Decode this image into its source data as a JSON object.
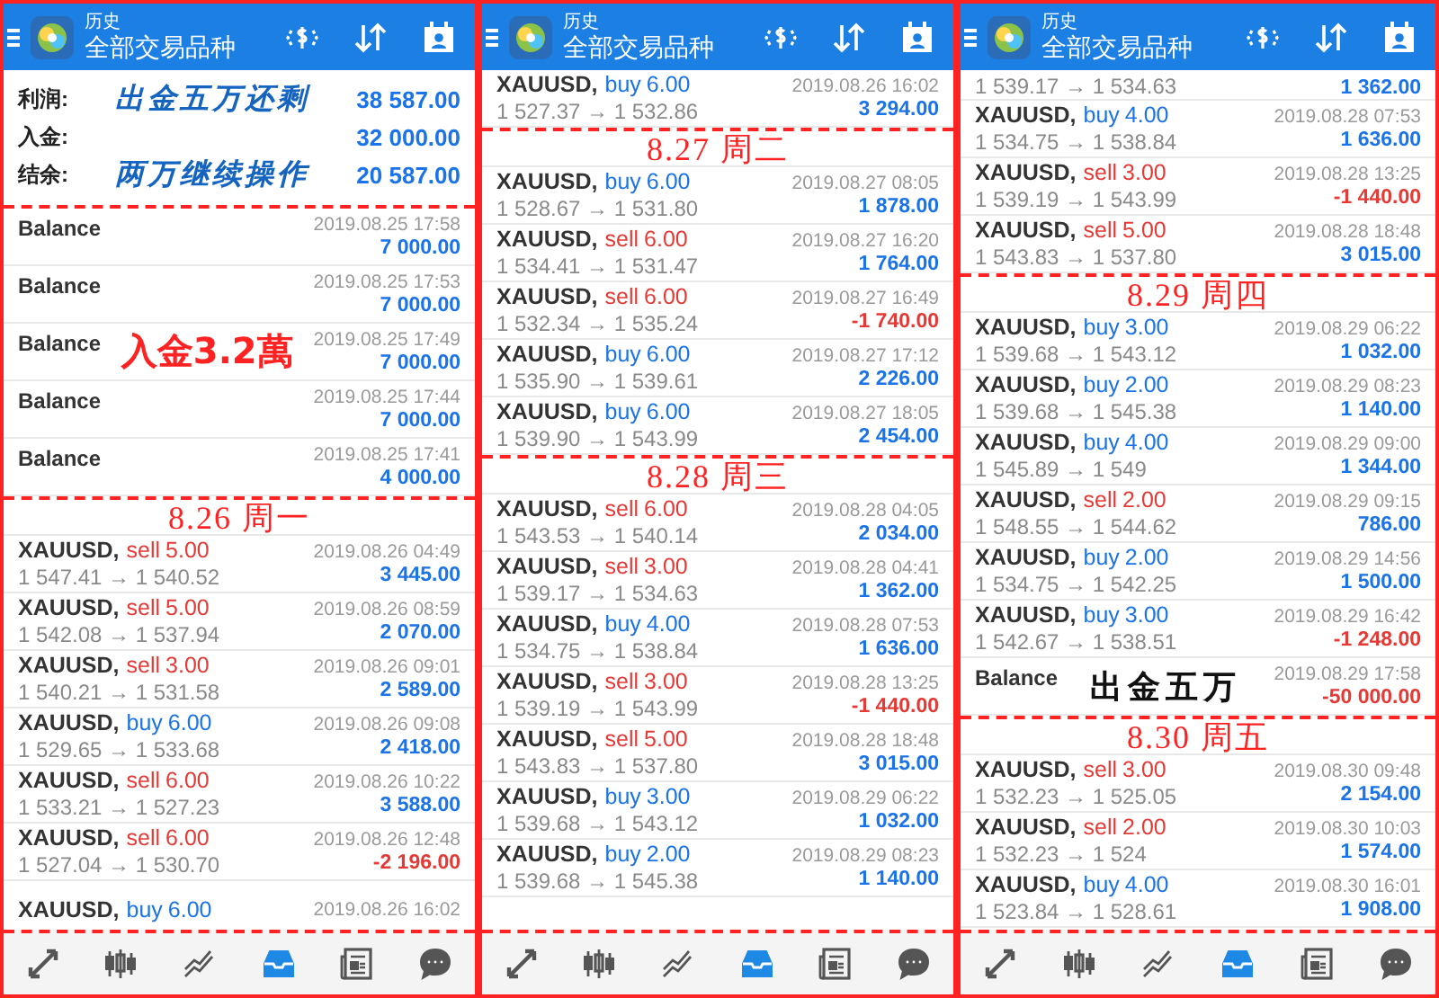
{
  "panels": [
    {
      "header": {
        "subtitle": "历史",
        "title": "全部交易品种"
      },
      "summary": [
        {
          "label": "利润:",
          "value": "38 587.00",
          "note": {
            "text": "出金五万还剩",
            "kind": "brush"
          }
        },
        {
          "label": "入金:",
          "value": "32 000.00"
        },
        {
          "label": "结余:",
          "value": "20 587.00",
          "note": {
            "text": "两万继续操作",
            "kind": "brush"
          }
        }
      ],
      "items": [
        {
          "kind": "balance",
          "label": "Balance",
          "time": "2019.08.25 17:58",
          "amount": "7 000.00",
          "negative": false
        },
        {
          "kind": "balance",
          "label": "Balance",
          "time": "2019.08.25 17:53",
          "amount": "7 000.00",
          "negative": false
        },
        {
          "kind": "balance",
          "label": "Balance",
          "time": "2019.08.25 17:49",
          "amount": "7 000.00",
          "negative": false,
          "note": {
            "text": "入金3.2萬",
            "kind": "stamp"
          }
        },
        {
          "kind": "balance",
          "label": "Balance",
          "time": "2019.08.25 17:44",
          "amount": "7 000.00",
          "negative": false
        },
        {
          "kind": "balance",
          "label": "Balance",
          "time": "2019.08.25 17:41",
          "amount": "4 000.00",
          "negative": false
        },
        {
          "kind": "note",
          "text": "8.26 周一"
        },
        {
          "kind": "trade",
          "symbol": "XAUUSD,",
          "side": "sell",
          "volume": "5.00",
          "color": "#e53935",
          "prices": "1 547.41 → 1 540.52",
          "time": "2019.08.26 04:49",
          "profit": "3 445.00",
          "negative": false
        },
        {
          "kind": "trade",
          "symbol": "XAUUSD,",
          "side": "sell",
          "volume": "5.00",
          "color": "#e53935",
          "prices": "1 542.08 → 1 537.94",
          "time": "2019.08.26 08:59",
          "profit": "2 070.00",
          "negative": false
        },
        {
          "kind": "trade",
          "symbol": "XAUUSD,",
          "side": "sell",
          "volume": "3.00",
          "color": "#e53935",
          "prices": "1 540.21 → 1 531.58",
          "time": "2019.08.26 09:01",
          "profit": "2 589.00",
          "negative": false
        },
        {
          "kind": "trade",
          "symbol": "XAUUSD,",
          "side": "buy",
          "volume": "6.00",
          "color": "#1a73e8",
          "prices": "1 529.65 → 1 533.68",
          "time": "2019.08.26 09:08",
          "profit": "2 418.00",
          "negative": false
        },
        {
          "kind": "trade",
          "symbol": "XAUUSD,",
          "side": "sell",
          "volume": "6.00",
          "color": "#e53935",
          "prices": "1 533.21 → 1 527.23",
          "time": "2019.08.26 10:22",
          "profit": "3 588.00",
          "negative": false
        },
        {
          "kind": "trade",
          "symbol": "XAUUSD,",
          "side": "sell",
          "volume": "6.00",
          "color": "#e53935",
          "prices": "1 527.04 → 1 530.70",
          "time": "2019.08.26 12:48",
          "profit": "-2 196.00",
          "negative": true
        },
        {
          "kind": "trade",
          "symbol": "XAUUSD,",
          "side": "buy",
          "volume": "6.00",
          "color": "#1a73e8",
          "time": "2019.08.26 16:02"
        }
      ],
      "nav": [
        {
          "selected": false
        },
        {
          "selected": false
        },
        {
          "selected": false
        },
        {
          "selected": true
        },
        {
          "selected": false
        },
        {
          "selected": false
        }
      ]
    },
    {
      "header": {
        "subtitle": "历史",
        "title": "全部交易品种"
      },
      "items": [
        {
          "kind": "trade",
          "symbol": "XAUUSD,",
          "side": "buy",
          "volume": "6.00",
          "color": "#1a73e8",
          "prices": "1 527.37 → 1 532.86",
          "time": "2019.08.26 16:02",
          "profit": "3 294.00",
          "negative": false
        },
        {
          "kind": "note",
          "text": "8.27 周二"
        },
        {
          "kind": "trade",
          "symbol": "XAUUSD,",
          "side": "buy",
          "volume": "6.00",
          "color": "#1a73e8",
          "prices": "1 528.67 → 1 531.80",
          "time": "2019.08.27 08:05",
          "profit": "1 878.00",
          "negative": false
        },
        {
          "kind": "trade",
          "symbol": "XAUUSD,",
          "side": "sell",
          "volume": "6.00",
          "color": "#e53935",
          "prices": "1 534.41 → 1 531.47",
          "time": "2019.08.27 16:20",
          "profit": "1 764.00",
          "negative": false
        },
        {
          "kind": "trade",
          "symbol": "XAUUSD,",
          "side": "sell",
          "volume": "6.00",
          "color": "#e53935",
          "prices": "1 532.34 → 1 535.24",
          "time": "2019.08.27 16:49",
          "profit": "-1 740.00",
          "negative": true
        },
        {
          "kind": "trade",
          "symbol": "XAUUSD,",
          "side": "buy",
          "volume": "6.00",
          "color": "#1a73e8",
          "prices": "1 535.90 → 1 539.61",
          "time": "2019.08.27 17:12",
          "profit": "2 226.00",
          "negative": false
        },
        {
          "kind": "trade",
          "symbol": "XAUUSD,",
          "side": "buy",
          "volume": "6.00",
          "color": "#1a73e8",
          "prices": "1 539.90 → 1 543.99",
          "time": "2019.08.27 18:05",
          "profit": "2 454.00",
          "negative": false
        },
        {
          "kind": "note",
          "text": "8.28 周三"
        },
        {
          "kind": "trade",
          "symbol": "XAUUSD,",
          "side": "sell",
          "volume": "6.00",
          "color": "#e53935",
          "prices": "1 543.53 → 1 540.14",
          "time": "2019.08.28 04:05",
          "profit": "2 034.00",
          "negative": false
        },
        {
          "kind": "trade",
          "symbol": "XAUUSD,",
          "side": "sell",
          "volume": "3.00",
          "color": "#e53935",
          "prices": "1 539.17 → 1 534.63",
          "time": "2019.08.28 04:41",
          "profit": "1 362.00",
          "negative": false
        },
        {
          "kind": "trade",
          "symbol": "XAUUSD,",
          "side": "buy",
          "volume": "4.00",
          "color": "#1a73e8",
          "prices": "1 534.75 → 1 538.84",
          "time": "2019.08.28 07:53",
          "profit": "1 636.00",
          "negative": false
        },
        {
          "kind": "trade",
          "symbol": "XAUUSD,",
          "side": "sell",
          "volume": "3.00",
          "color": "#e53935",
          "prices": "1 539.19 → 1 543.99",
          "time": "2019.08.28 13:25",
          "profit": "-1 440.00",
          "negative": true
        },
        {
          "kind": "trade",
          "symbol": "XAUUSD,",
          "side": "sell",
          "volume": "5.00",
          "color": "#e53935",
          "prices": "1 543.83 → 1 537.80",
          "time": "2019.08.28 18:48",
          "profit": "3 015.00",
          "negative": false
        },
        {
          "kind": "trade",
          "symbol": "XAUUSD,",
          "side": "buy",
          "volume": "3.00",
          "color": "#1a73e8",
          "prices": "1 539.68 → 1 543.12",
          "time": "2019.08.29 06:22",
          "profit": "1 032.00",
          "negative": false
        },
        {
          "kind": "trade",
          "symbol": "XAUUSD,",
          "side": "buy",
          "volume": "2.00",
          "color": "#1a73e8",
          "prices": "1 539.68 → 1 545.38",
          "time": "2019.08.29 08:23",
          "profit": "1 140.00",
          "negative": false
        }
      ],
      "nav": [
        {
          "selected": false
        },
        {
          "selected": false
        },
        {
          "selected": false
        },
        {
          "selected": true
        },
        {
          "selected": false
        },
        {
          "selected": false
        }
      ]
    },
    {
      "header": {
        "subtitle": "历史",
        "title": "全部交易品种"
      },
      "items": [
        {
          "kind": "trade",
          "prices": "1 539.17 → 1 534.63",
          "profit": "1 362.00",
          "negative": false
        },
        {
          "kind": "trade",
          "symbol": "XAUUSD,",
          "side": "buy",
          "volume": "4.00",
          "color": "#1a73e8",
          "prices": "1 534.75 → 1 538.84",
          "time": "2019.08.28 07:53",
          "profit": "1 636.00",
          "negative": false
        },
        {
          "kind": "trade",
          "symbol": "XAUUSD,",
          "side": "sell",
          "volume": "3.00",
          "color": "#e53935",
          "prices": "1 539.19 → 1 543.99",
          "time": "2019.08.28 13:25",
          "profit": "-1 440.00",
          "negative": true
        },
        {
          "kind": "trade",
          "symbol": "XAUUSD,",
          "side": "sell",
          "volume": "5.00",
          "color": "#e53935",
          "prices": "1 543.83 → 1 537.80",
          "time": "2019.08.28 18:48",
          "profit": "3 015.00",
          "negative": false
        },
        {
          "kind": "note",
          "text": "8.29 周四"
        },
        {
          "kind": "trade",
          "symbol": "XAUUSD,",
          "side": "buy",
          "volume": "3.00",
          "color": "#1a73e8",
          "prices": "1 539.68 → 1 543.12",
          "time": "2019.08.29 06:22",
          "profit": "1 032.00",
          "negative": false
        },
        {
          "kind": "trade",
          "symbol": "XAUUSD,",
          "side": "buy",
          "volume": "2.00",
          "color": "#1a73e8",
          "prices": "1 539.68 → 1 545.38",
          "time": "2019.08.29 08:23",
          "profit": "1 140.00",
          "negative": false
        },
        {
          "kind": "trade",
          "symbol": "XAUUSD,",
          "side": "buy",
          "volume": "4.00",
          "color": "#1a73e8",
          "prices": "1 545.89 → 1 549",
          "time": "2019.08.29 09:00",
          "profit": "1 344.00",
          "negative": false
        },
        {
          "kind": "trade",
          "symbol": "XAUUSD,",
          "side": "sell",
          "volume": "2.00",
          "color": "#e53935",
          "prices": "1 548.55 → 1 544.62",
          "time": "2019.08.29 09:15",
          "profit": "786.00",
          "negative": false
        },
        {
          "kind": "trade",
          "symbol": "XAUUSD,",
          "side": "buy",
          "volume": "2.00",
          "color": "#1a73e8",
          "prices": "1 534.75 → 1 542.25",
          "time": "2019.08.29 14:56",
          "profit": "1 500.00",
          "negative": false
        },
        {
          "kind": "trade",
          "symbol": "XAUUSD,",
          "side": "buy",
          "volume": "3.00",
          "color": "#1a73e8",
          "prices": "1 542.67 → 1 538.51",
          "time": "2019.08.29 16:42",
          "profit": "-1 248.00",
          "negative": true
        },
        {
          "kind": "balance",
          "label": "Balance",
          "time": "2019.08.29 17:58",
          "amount": "-50 000.00",
          "negative": true,
          "note": {
            "text": "出金五万",
            "kind": "ink"
          }
        },
        {
          "kind": "note",
          "text": "8.30 周五"
        },
        {
          "kind": "trade",
          "symbol": "XAUUSD,",
          "side": "sell",
          "volume": "3.00",
          "color": "#e53935",
          "prices": "1 532.23 → 1 525.05",
          "time": "2019.08.30 09:48",
          "profit": "2 154.00",
          "negative": false
        },
        {
          "kind": "trade",
          "symbol": "XAUUSD,",
          "side": "sell",
          "volume": "2.00",
          "color": "#e53935",
          "prices": "1 532.23 → 1 524",
          "time": "2019.08.30 10:03",
          "profit": "1 574.00",
          "negative": false
        },
        {
          "kind": "trade",
          "symbol": "XAUUSD,",
          "side": "buy",
          "volume": "4.00",
          "color": "#1a73e8",
          "prices": "1 523.84 → 1 528.61",
          "time": "2019.08.30 16:01",
          "profit": "1 908.00",
          "negative": false
        }
      ],
      "nav": [
        {
          "selected": false
        },
        {
          "selected": false
        },
        {
          "selected": false
        },
        {
          "selected": true
        },
        {
          "selected": false
        },
        {
          "selected": false
        }
      ]
    }
  ]
}
